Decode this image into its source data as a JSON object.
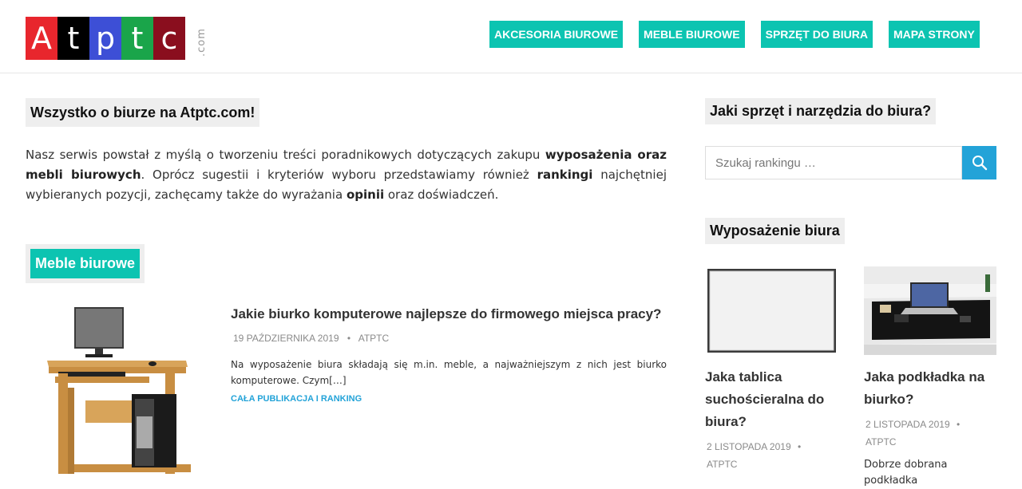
{
  "logo": {
    "letters": [
      "A",
      "t",
      "p",
      "t",
      "c"
    ],
    "colors": [
      "#e8262d",
      "#000000",
      "#3d4fd6",
      "#1aa54a",
      "#8a0e1e"
    ],
    "suffix": ".com"
  },
  "nav": {
    "items": [
      {
        "label": "AKCESORIA BIUROWE"
      },
      {
        "label": "MEBLE BIUROWE"
      },
      {
        "label": "SPRZĘT DO BIURA"
      },
      {
        "label": "MAPA STRONY"
      }
    ]
  },
  "main": {
    "title": "Wszystko o biurze na Atptc.com!",
    "intro": {
      "p1": "Nasz serwis powstał z myślą o tworzeniu treści poradnikowych dotyczących zakupu ",
      "b1": "wyposażenia oraz mebli biurowych",
      "p2": ". Oprócz sugestii i kryteriów wyboru przedstawiamy również ",
      "b2": "rankingi",
      "p3": " najchętniej wybieranych pozycji, zachęcamy także do wyrażania ",
      "b3": "opinii",
      "p4": " oraz doświadczeń."
    },
    "category": "Meble biurowe",
    "post": {
      "title": "Jakie biurko komputerowe najlepsze do firmowego miejsca pracy?",
      "date": "19 PAŹDZIERNIKA 2019",
      "author": "ATPTC",
      "excerpt": "Na wyposażenie biura składają się m.in. meble, a najważniejszym z nich jest biurko komputerowe. Czym[…]",
      "more": "CAŁA PUBLIKACJA I RANKING"
    }
  },
  "sidebar": {
    "tools_title": "Jaki sprzęt i narzędzia do biura?",
    "search_placeholder": "Szukaj rankingu …",
    "equipment_title": "Wyposażenie biura",
    "cards": [
      {
        "title": "Jaka tablica suchościeralna do biura?",
        "date": "2 LISTOPADA 2019",
        "author": "ATPTC",
        "excerpt": ""
      },
      {
        "title": "Jaka podkładka na biurko?",
        "date": "2 LISTOPADA 2019",
        "author": "ATPTC",
        "excerpt": "Dobrze dobrana podkładka"
      }
    ]
  },
  "colors": {
    "accent": "#0cc4b1",
    "link": "#23a3d8"
  }
}
